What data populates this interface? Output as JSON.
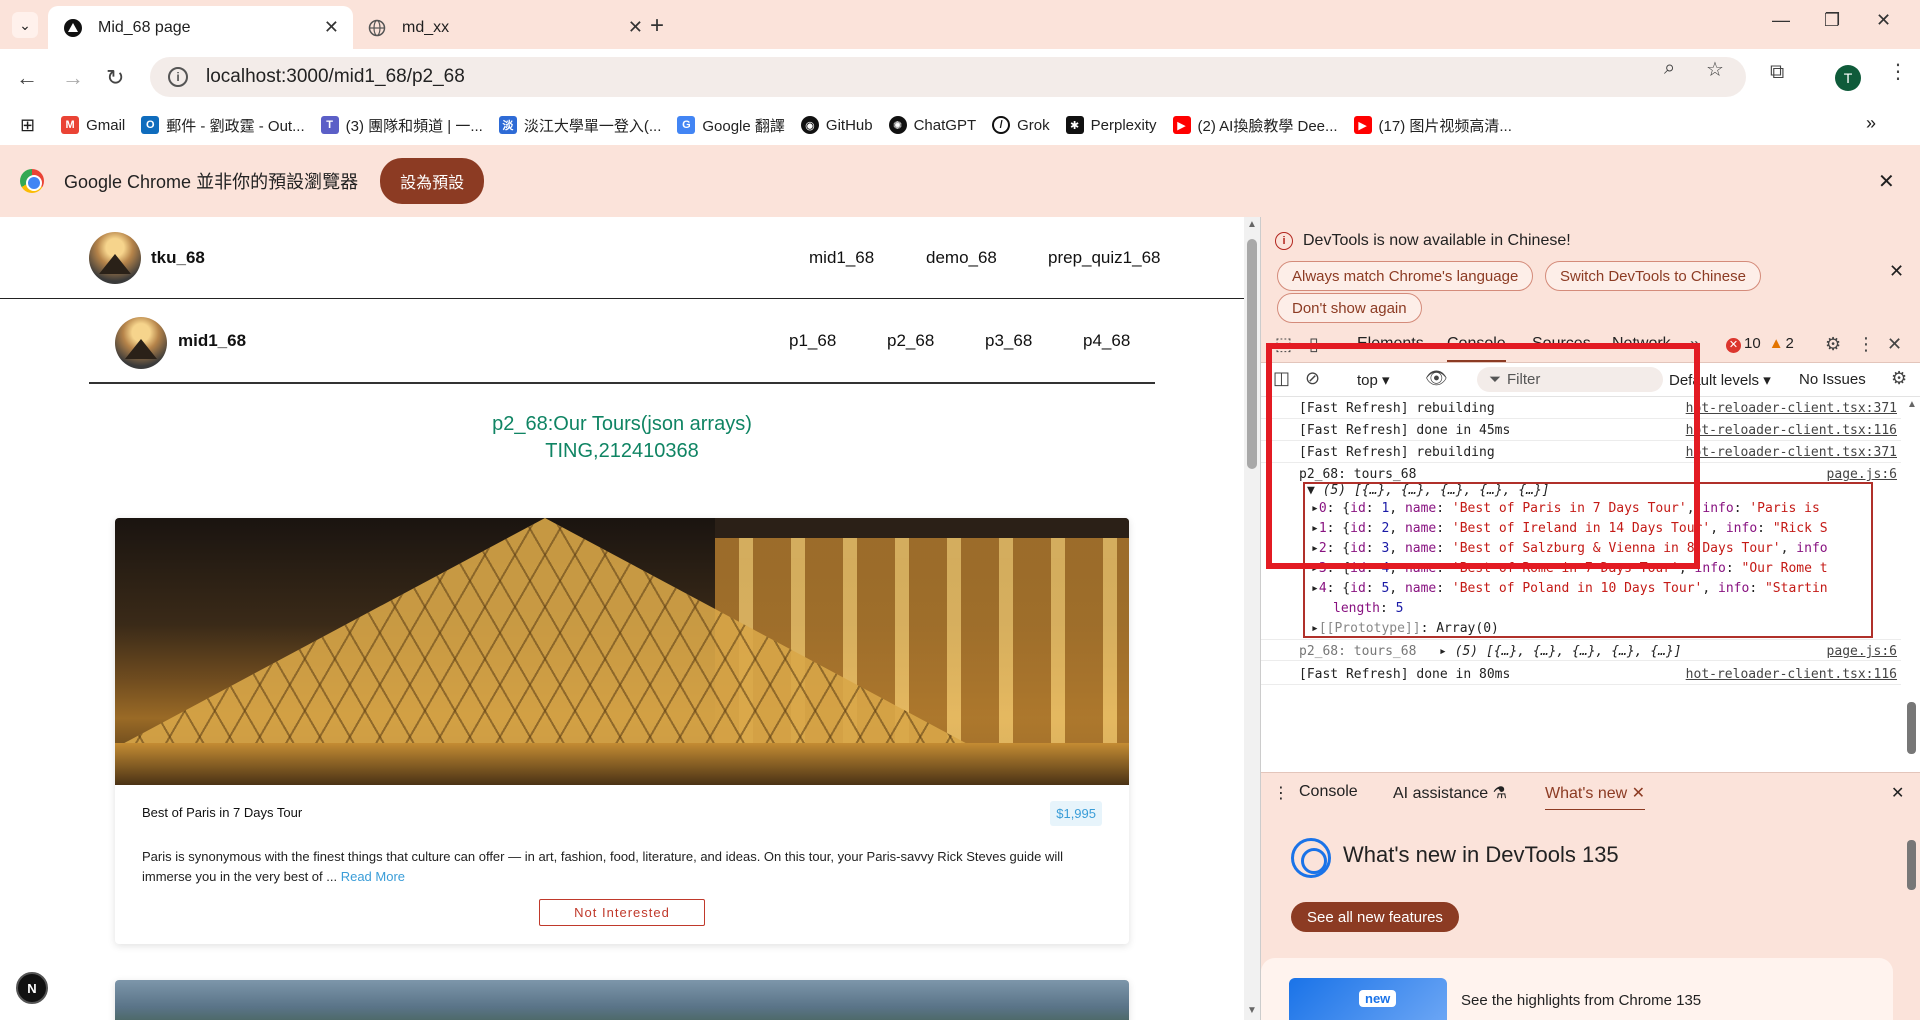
{
  "browser": {
    "tabs": [
      {
        "title": "Mid_68 page",
        "icon": "nextjs-triangle-icon"
      },
      {
        "title": "md_xx",
        "icon": "globe-icon"
      }
    ],
    "url": "localhost:3000/mid1_68/p2_68",
    "profile_initial": "T",
    "bookmarks": [
      {
        "label": "Gmail",
        "icon": "gmail-icon",
        "color": "#ea4335"
      },
      {
        "label": "郵件 - 劉政霆 - Out...",
        "icon": "outlook-icon",
        "color": "#0f6cbd"
      },
      {
        "label": "(3) 團隊和頻道 | 一...",
        "icon": "teams-icon",
        "color": "#5b5fc7"
      },
      {
        "label": "淡江大學單一登入(...",
        "icon": "tku-icon",
        "color": "#2e6bd6"
      },
      {
        "label": "Google 翻譯",
        "icon": "translate-icon",
        "color": "#4285f4"
      },
      {
        "label": "GitHub",
        "icon": "github-icon",
        "color": "#111111"
      },
      {
        "label": "ChatGPT",
        "icon": "chatgpt-icon",
        "color": "#111111"
      },
      {
        "label": "Grok",
        "icon": "grok-icon",
        "color": "#111111"
      },
      {
        "label": "Perplexity",
        "icon": "perplexity-icon",
        "color": "#111111"
      },
      {
        "label": "(2) AI換臉教學 Dee...",
        "icon": "youtube-icon",
        "color": "#ff0000"
      },
      {
        "label": "(17) 图片视频高清...",
        "icon": "youtube-icon",
        "color": "#ff0000"
      }
    ],
    "infobar": {
      "message": "Google Chrome 並非你的預設瀏覽器",
      "button": "設為預設"
    }
  },
  "page": {
    "top_nav": {
      "brand": "tku_68",
      "links": [
        "mid1_68",
        "demo_68",
        "prep_quiz1_68"
      ]
    },
    "sub_nav": {
      "brand": "mid1_68",
      "links": [
        "p1_68",
        "p2_68",
        "p3_68",
        "p4_68"
      ]
    },
    "title": "p2_68:Our Tours(json arrays)",
    "subtitle": "TING,212410368",
    "tours": [
      {
        "name": "Best of Paris in 7 Days Tour",
        "price": "$1,995",
        "info": "Paris is synonymous with the finest things that culture can offer — in art, fashion, food, literature, and ideas. On this tour, your Paris-savvy Rick Steves guide will immerse you in the very best of ...",
        "read_more": "Read More",
        "button": "Not Interested"
      }
    ],
    "next_badge": "N"
  },
  "devtools": {
    "banner": {
      "message": "DevTools is now available in Chinese!",
      "buttons": [
        "Always match Chrome's language",
        "Switch DevTools to Chinese",
        "Don't show again"
      ]
    },
    "tabs": [
      "Elements",
      "Console",
      "Sources",
      "Network"
    ],
    "active_tab": "Console",
    "errors": "10",
    "warnings": "2",
    "context": "top",
    "filter_placeholder": "Filter",
    "levels": "Default levels",
    "issues": "No Issues",
    "console_lines": [
      {
        "text": "[Fast Refresh] rebuilding",
        "src": "hot-reloader-client.tsx:371"
      },
      {
        "text": "[Fast Refresh] done in 45ms",
        "src": "hot-reloader-client.tsx:116"
      },
      {
        "text": "[Fast Refresh] rebuilding",
        "src": "hot-reloader-client.tsx:371"
      },
      {
        "text": "p2_68: tours_68",
        "src": "page.js:6"
      }
    ],
    "array_summary": "(5) [{…}, {…}, {…}, {…}, {…}]",
    "array_items": [
      {
        "idx": "0",
        "id": "1",
        "name": "'Best of Paris in 7 Days Tour'",
        "info": "'Paris is"
      },
      {
        "idx": "1",
        "id": "2",
        "name": "'Best of Ireland in 14 Days Tour'",
        "info": "\"Rick S"
      },
      {
        "idx": "2",
        "id": "3",
        "name": "'Best of Salzburg & Vienna in 8 Days Tour'",
        "info": ""
      },
      {
        "idx": "3",
        "id": "4",
        "name": "'Best of Rome in 7 Days Tour'",
        "info": "\"Our Rome t"
      },
      {
        "idx": "4",
        "id": "5",
        "name": "'Best of Poland in 10 Days Tour'",
        "info": "\"Startin"
      }
    ],
    "length_label": "length",
    "length_value": "5",
    "prototype": "[[Prototype]]",
    "prototype_value": "Array(0)",
    "log2": {
      "text": "p2_68: tours_68",
      "summary": "(5) [{…}, {…}, {…}, {…}, {…}]",
      "src": "page.js:6"
    },
    "log3": {
      "text": "[Fast Refresh] done in 80ms",
      "src": "hot-reloader-client.tsx:116"
    },
    "drawer_tabs": [
      "Console",
      "AI assistance",
      "What's new"
    ],
    "whats_new_title": "What's new in DevTools 135",
    "see_all": "See all new features",
    "new_badge": "new",
    "highlight_text": "See the highlights from Chrome 135"
  },
  "colors": {
    "accent": "#8c3b23",
    "title_green": "#0f8463",
    "highlight_red": "#e31b23",
    "price_blue": "#3a9dd8"
  }
}
